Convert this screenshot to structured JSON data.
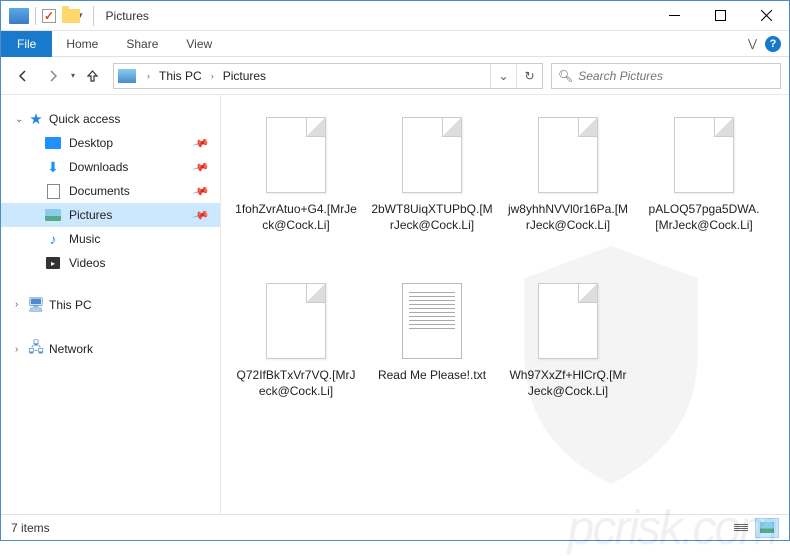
{
  "title": "Pictures",
  "ribbon": {
    "file": "File",
    "tabs": [
      "Home",
      "Share",
      "View"
    ]
  },
  "breadcrumb": {
    "segments": [
      "This PC",
      "Pictures"
    ]
  },
  "search": {
    "placeholder": "Search Pictures"
  },
  "navtree": {
    "quick_access": {
      "label": "Quick access",
      "items": [
        {
          "label": "Desktop",
          "pinned": true
        },
        {
          "label": "Downloads",
          "pinned": true
        },
        {
          "label": "Documents",
          "pinned": true
        },
        {
          "label": "Pictures",
          "pinned": true,
          "selected": true
        },
        {
          "label": "Music",
          "pinned": false
        },
        {
          "label": "Videos",
          "pinned": false
        }
      ]
    },
    "this_pc": {
      "label": "This PC"
    },
    "network": {
      "label": "Network"
    }
  },
  "files": [
    {
      "name": "1fohZvrAtuo+G4.[MrJeck@Cock.Li]",
      "type": "blank"
    },
    {
      "name": "2bWT8UiqXTUPbQ.[MrJeck@Cock.Li]",
      "type": "blank"
    },
    {
      "name": "jw8yhhNVVl0r16Pa.[MrJeck@Cock.Li]",
      "type": "blank"
    },
    {
      "name": "pALOQ57pga5DWA.[MrJeck@Cock.Li]",
      "type": "blank"
    },
    {
      "name": "Q72IfBkTxVr7VQ.[MrJeck@Cock.Li]",
      "type": "blank"
    },
    {
      "name": "Read Me Please!.txt",
      "type": "txt"
    },
    {
      "name": "Wh97XxZf+HlCrQ.[MrJeck@Cock.Li]",
      "type": "blank"
    }
  ],
  "status": {
    "count_label": "7 items"
  }
}
